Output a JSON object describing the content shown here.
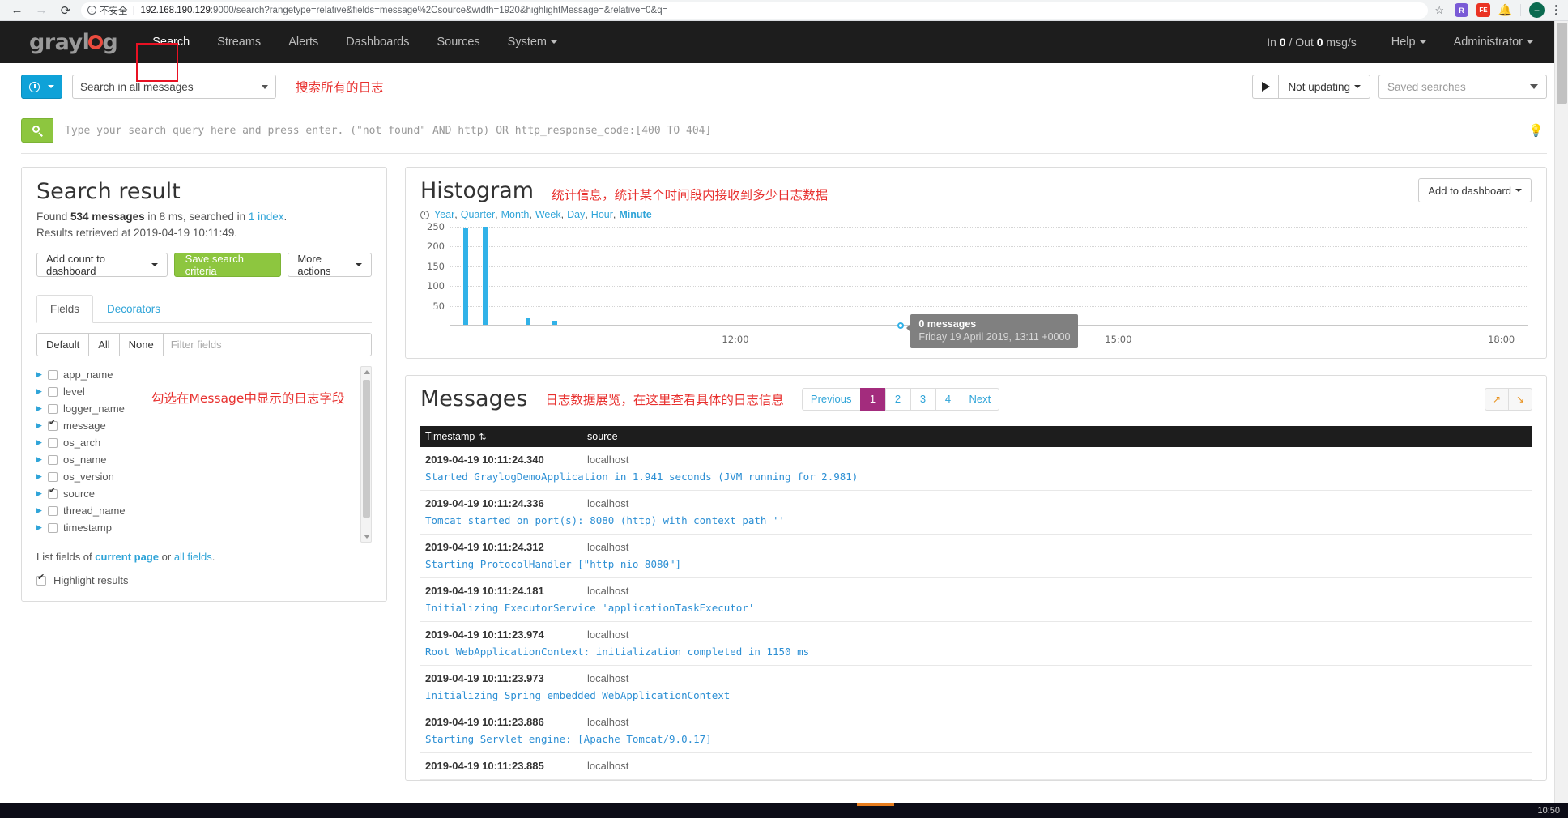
{
  "browser": {
    "back_icon": "back-arrow-icon",
    "forward_icon": "forward-arrow-icon",
    "reload_icon": "reload-icon",
    "security_label": "不安全",
    "url_host": "192.168.190.129",
    "url_rest": ":9000/search?rangetype=relative&fields=message%2Csource&width=1920&highlightMessage=&relative=0&q=",
    "star_icon": "★",
    "extensions": [
      {
        "name": "extension-r-icon",
        "label": "R"
      },
      {
        "name": "extension-fe-icon",
        "label": "FE"
      },
      {
        "name": "extension-bell-icon",
        "label": "🔔"
      }
    ],
    "profile_label": "—",
    "menu_icon": "three-dots-menu-icon"
  },
  "navbar": {
    "logo_gray": "gray",
    "logo_l": "l",
    "logo_g": "g",
    "items": [
      {
        "label": "Search",
        "active": true
      },
      {
        "label": "Streams",
        "active": false
      },
      {
        "label": "Alerts",
        "active": false
      },
      {
        "label": "Dashboards",
        "active": false
      },
      {
        "label": "Sources",
        "active": false
      },
      {
        "label": "System",
        "active": false,
        "caret": true
      }
    ],
    "throughput_prefix": "In ",
    "throughput_in": "0",
    "throughput_mid": " / Out ",
    "throughput_out": "0",
    "throughput_suffix": " msg/s",
    "help_label": "Help",
    "user_label": "Administrator"
  },
  "searchbar": {
    "timerange_icon": "clock-icon",
    "range_value": "Search in all messages",
    "annotation": "搜索所有的日志",
    "play_icon": "play-icon",
    "refresh_label": "Not updating",
    "saved_searches_placeholder": "Saved searches",
    "query_value": "",
    "query_placeholder": "Type your search query here and press enter. (\"not found\" AND http) OR http_response_code:[400 TO 404]",
    "bulb_icon": "lightbulb-icon",
    "submit_icon": "search-icon"
  },
  "search_result": {
    "title": "Search result",
    "found_prefix": "Found ",
    "found_count": "534 messages",
    "found_mid": " in 8 ms, searched in ",
    "index_link": "1 index",
    "found_suffix": ".",
    "retrieved_line": "Results retrieved at 2019-04-19 10:11:49.",
    "buttons": {
      "add_count": "Add count to dashboard",
      "save_criteria": "Save search criteria",
      "more_actions": "More actions"
    },
    "tabs": [
      {
        "label": "Fields",
        "active": true
      },
      {
        "label": "Decorators",
        "active": false
      }
    ],
    "field_filter": {
      "default_label": "Default",
      "all_label": "All",
      "none_label": "None",
      "placeholder": "Filter fields",
      "value": ""
    },
    "annotation": "勾选在Message中显示的日志字段",
    "fields": [
      {
        "name": "app_name",
        "checked": false
      },
      {
        "name": "level",
        "checked": false
      },
      {
        "name": "logger_name",
        "checked": false
      },
      {
        "name": "message",
        "checked": true
      },
      {
        "name": "os_arch",
        "checked": false
      },
      {
        "name": "os_name",
        "checked": false
      },
      {
        "name": "os_version",
        "checked": false
      },
      {
        "name": "source",
        "checked": true
      },
      {
        "name": "thread_name",
        "checked": false
      },
      {
        "name": "timestamp",
        "checked": false
      }
    ],
    "list_fields_prefix": "List fields of ",
    "list_fields_current": "current page",
    "list_fields_or": " or ",
    "list_fields_all": "all fields",
    "list_fields_suffix": ".",
    "highlight_label": "Highlight results",
    "highlight_checked": true
  },
  "histogram": {
    "title": "Histogram",
    "annotation": "统计信息，统计某个时间段内接收到多少日志数据",
    "add_to_dashboard": "Add to dashboard",
    "clock_icon": "clock-icon",
    "resolutions": [
      {
        "label": "Year",
        "active": false
      },
      {
        "label": "Quarter",
        "active": false
      },
      {
        "label": "Month",
        "active": false
      },
      {
        "label": "Week",
        "active": false
      },
      {
        "label": "Day",
        "active": false
      },
      {
        "label": "Hour",
        "active": false
      },
      {
        "label": "Minute",
        "active": true
      }
    ],
    "tooltip": {
      "count": "0 messages",
      "time": "Friday 19 April 2019, 13:11 +0000"
    }
  },
  "chart_data": {
    "type": "bar",
    "title": "Histogram",
    "xlabel": "",
    "ylabel": "",
    "ylim": [
      0,
      250
    ],
    "yticks": [
      50,
      100,
      150,
      200,
      250
    ],
    "xticks": [
      "12:00",
      "15:00",
      "18:00"
    ],
    "grid": true,
    "legend": false,
    "x": [
      "10:11",
      "10:13",
      "10:19",
      "10:23"
    ],
    "values": [
      243,
      249,
      16,
      10
    ],
    "x_positions_pct": [
      1.2,
      3.0,
      7.0,
      9.5
    ],
    "xtick_positions_pct": [
      26.5,
      62.0,
      97.5
    ],
    "hover_x_pct": 41.8,
    "hover_value": 0
  },
  "messages": {
    "title": "Messages",
    "annotation": "日志数据展览，在这里查看具体的日志信息",
    "pagination": {
      "previous": "Previous",
      "pages": [
        "1",
        "2",
        "3",
        "4"
      ],
      "active_page": "1",
      "next": "Next"
    },
    "expand_icon": "expand-icon",
    "collapse_icon": "collapse-icon",
    "columns": [
      "Timestamp",
      "source"
    ],
    "sort_icon": "sort-descending-icon",
    "rows": [
      {
        "timestamp": "2019-04-19 10:11:24.340",
        "source": "localhost",
        "message": "Started GraylogDemoApplication in 1.941 seconds (JVM running for 2.981)"
      },
      {
        "timestamp": "2019-04-19 10:11:24.336",
        "source": "localhost",
        "message": "Tomcat started on port(s): 8080 (http) with context path ''"
      },
      {
        "timestamp": "2019-04-19 10:11:24.312",
        "source": "localhost",
        "message": "Starting ProtocolHandler [\"http-nio-8080\"]"
      },
      {
        "timestamp": "2019-04-19 10:11:24.181",
        "source": "localhost",
        "message": "Initializing ExecutorService 'applicationTaskExecutor'"
      },
      {
        "timestamp": "2019-04-19 10:11:23.974",
        "source": "localhost",
        "message": "Root WebApplicationContext: initialization completed in 1150 ms"
      },
      {
        "timestamp": "2019-04-19 10:11:23.973",
        "source": "localhost",
        "message": "Initializing Spring embedded WebApplicationContext"
      },
      {
        "timestamp": "2019-04-19 10:11:23.886",
        "source": "localhost",
        "message": "Starting Servlet engine: [Apache Tomcat/9.0.17]"
      },
      {
        "timestamp": "2019-04-19 10:11:23.885",
        "source": "localhost",
        "message": ""
      }
    ]
  },
  "taskbar": {
    "clock": "10:50"
  },
  "colors": {
    "accent_blue": "#2fa4d8",
    "bar_blue": "#31b2e8",
    "green": "#8dc63f",
    "magenta": "#a32c7d",
    "annotation_red": "#e8312f",
    "navbar_dark": "#1d1d1d"
  }
}
